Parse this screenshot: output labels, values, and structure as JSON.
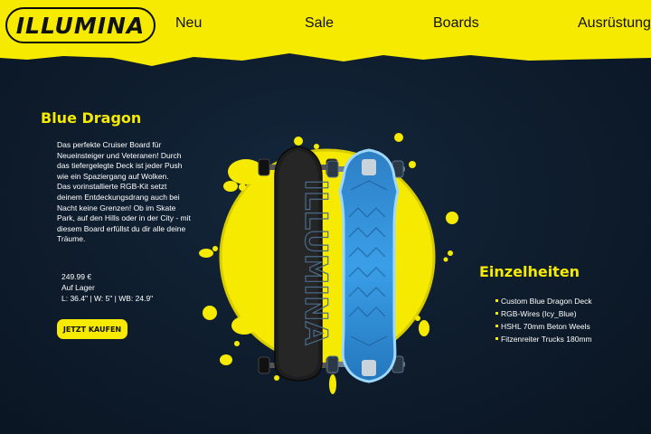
{
  "colors": {
    "accent": "#f5ea00",
    "background": "#0e1c2c",
    "board_blue": "#3aa6f0",
    "board_black": "#1a1a1a"
  },
  "header": {
    "logo_text": "ILLUMINA",
    "nav": [
      {
        "label": "Neu"
      },
      {
        "label": "Sale"
      },
      {
        "label": "Boards"
      },
      {
        "label": "Ausrüstung"
      }
    ]
  },
  "product": {
    "title": "Blue Dragon",
    "description": [
      "Das perfekte Cruiser Board für Neueinsteiger und Veteranen! Durch das tiefergelegte Deck ist jeder Push wie ein Spaziergang auf Wolken.",
      "Das vorinstallierte RGB-Kit setzt deinem Entdeckungsdrang auch bei Nacht keine Grenzen! Ob im Skate Park, auf den Hills oder in der City - mit diesem Board erfüllst du dir alle deine Träume."
    ],
    "price": "249.99 €",
    "stock": "Auf Lager",
    "dimensions": "L: 36.4\" | W: 5\" | WB: 24.9\"",
    "buy_label": "JETZT KAUFEN",
    "deck_brand_text": "ILLUMINA"
  },
  "details": {
    "title": "Einzelheiten",
    "items": [
      "Custom Blue Dragon Deck",
      "RGB-Wires (Icy_Blue)",
      "HSHL 70mm Beton Weels",
      "Fitzenreiter Trucks 180mm"
    ]
  }
}
